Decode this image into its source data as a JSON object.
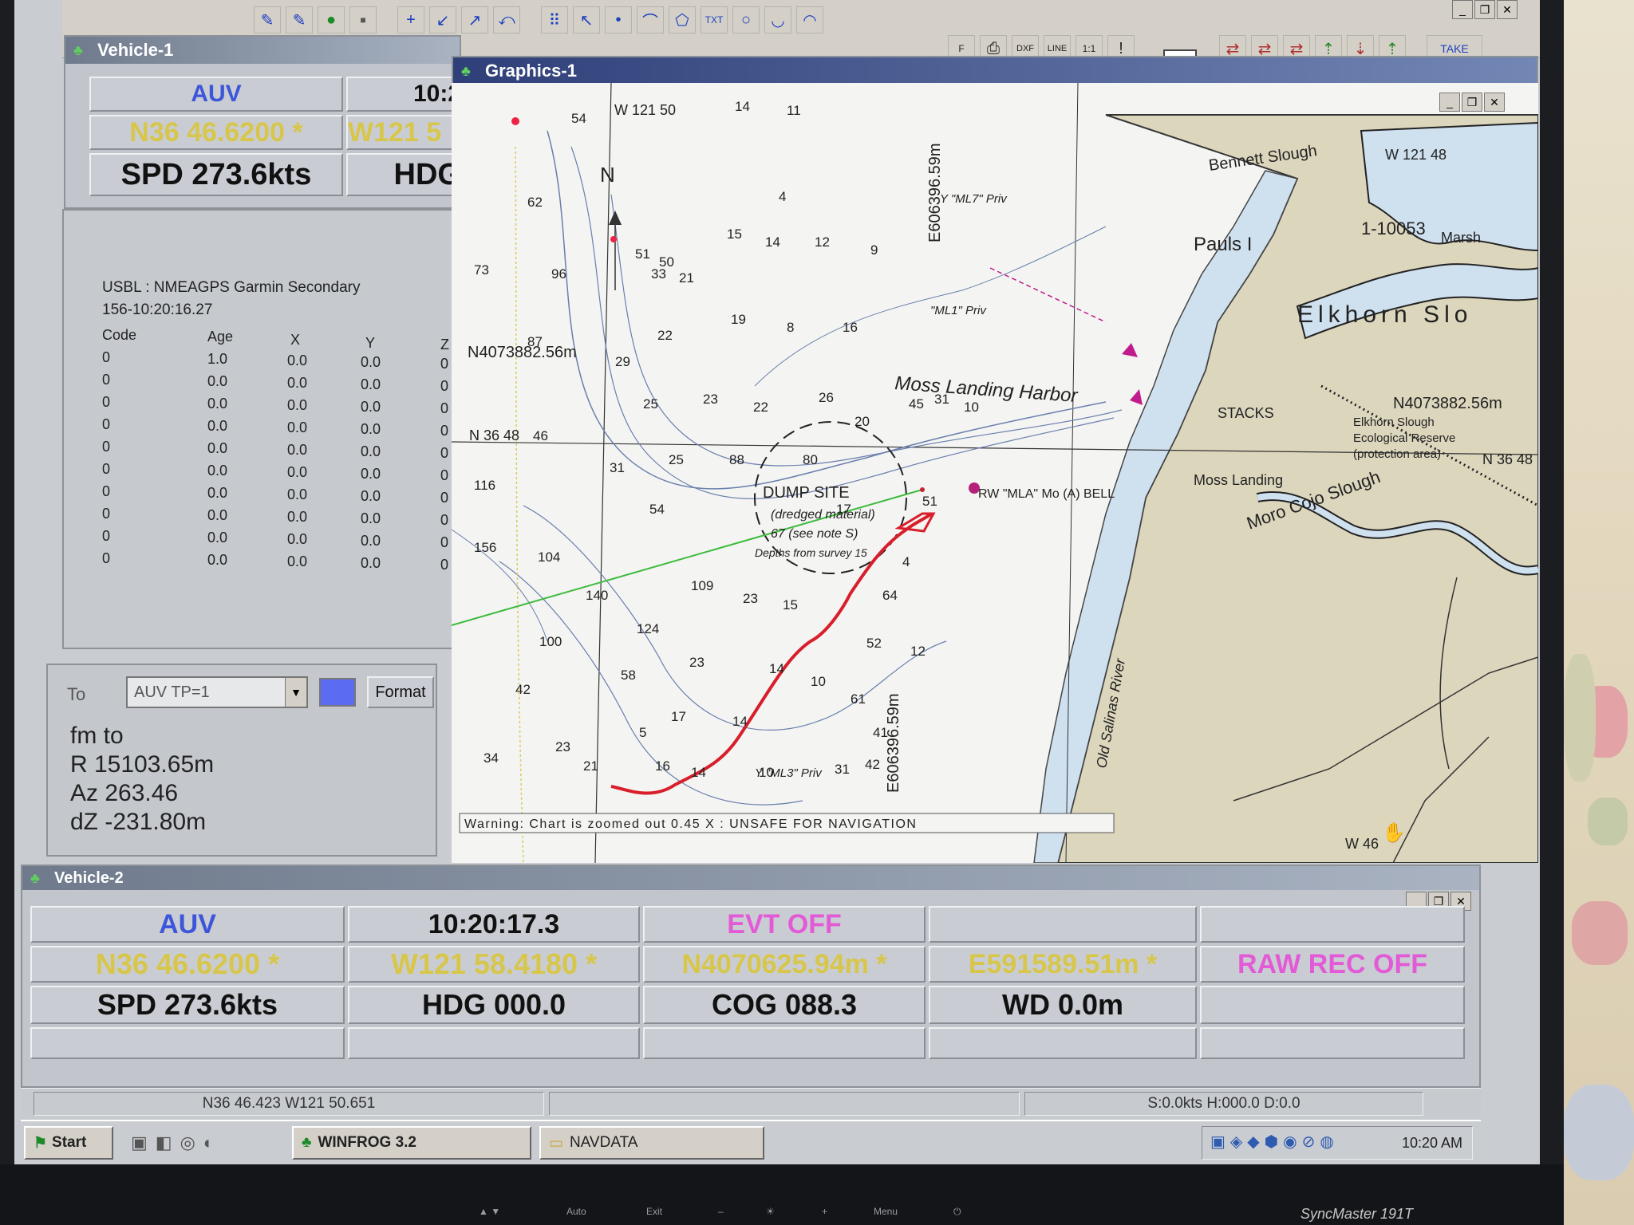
{
  "toolbar": {
    "buttons": [
      "+",
      "↙",
      "↗",
      "⤺",
      "⠿",
      "↖",
      "•",
      "⌒",
      "⬠",
      "TXT",
      "○",
      "◡",
      "◠"
    ],
    "extra": [
      "F",
      "⎙",
      "DXF",
      "LINE",
      "1:1",
      "!"
    ],
    "zoom_value": "1",
    "take_label": "TAKE"
  },
  "vehicle1": {
    "title": "Vehicle-1",
    "name": "AUV",
    "time": "10:2",
    "lat": "N36 46.6200 *",
    "lon": "W121 5",
    "speed": "SPD 273.6kts",
    "heading": "HDG"
  },
  "usbl": {
    "source": "USBL : NMEAGPS Garmin Secondary",
    "timestamp": "156-10:20:16.27",
    "headers": [
      "Code",
      "Age",
      "X",
      "Y",
      "Z"
    ],
    "rows": [
      [
        "0",
        "1.0",
        "0.0",
        "0.0",
        "0"
      ],
      [
        "0",
        "0.0",
        "0.0",
        "0.0",
        "0"
      ],
      [
        "0",
        "0.0",
        "0.0",
        "0.0",
        "0"
      ],
      [
        "0",
        "0.0",
        "0.0",
        "0.0",
        "0"
      ],
      [
        "0",
        "0.0",
        "0.0",
        "0.0",
        "0"
      ],
      [
        "0",
        "0.0",
        "0.0",
        "0.0",
        "0"
      ],
      [
        "0",
        "0.0",
        "0.0",
        "0.0",
        "0"
      ],
      [
        "0",
        "0.0",
        "0.0",
        "0.0",
        "0"
      ],
      [
        "0",
        "0.0",
        "0.0",
        "0.0",
        "0"
      ],
      [
        "0",
        "0.0",
        "0.0",
        "0.0",
        "0"
      ]
    ]
  },
  "target": {
    "to_label": "To",
    "selected": "AUV TP=1",
    "color": "#5b6cf2",
    "format_label": "Format",
    "fm_to": "fm  to",
    "range": "R  15103.65m",
    "azimuth": "Az 263.46",
    "dz": "dZ -231.80m"
  },
  "graphics": {
    "title": "Graphics-1",
    "warning": "Warning: Chart is zoomed out 0.45 X : UNSAFE FOR NAVIGATION",
    "labels": {
      "harbor": "Moss Landing Harbor",
      "slough": "Elkhorn Slo",
      "bennett": "Bennett Slough",
      "pauls": "Pauls I",
      "marsh": "Marsh",
      "moro_cojo": "Moro Cojo Slough",
      "moss_landing": "Moss Landing",
      "stacks": "STACKS",
      "dump_site": "DUMP SITE",
      "dump_note1": "(dredged material)",
      "dump_note2": "67 (see note S)",
      "dump_note3": "Depths from survey 15",
      "old_salinas": "Old Salinas River",
      "reserve1": "Elkhorn Slough",
      "reserve2": "Ecological Reserve",
      "reserve3": "(protection area)",
      "north": "N",
      "grid_n1": "N4073882.56m",
      "grid_n2": "N4073882.56m",
      "grid_e1": "E606396.59m",
      "grid_e2": "E606396.59m",
      "lat_left": "N 36 48",
      "lat_right": "N 36 48",
      "lon_top": "W 121 50",
      "lon_top2": "W 121 48",
      "lon_bottom": "W 46",
      "ref_num": "1-10053",
      "mla": "RW \"MLA\" Mo (A) BELL",
      "ml3": "Y \"ML3\" Priv",
      "ml7": "Y \"ML7\" Priv",
      "ml1": "\"ML1\" Priv"
    },
    "depths": [
      [
        "54",
        150,
        50
      ],
      [
        "51",
        230,
        220
      ],
      [
        "50",
        260,
        230
      ],
      [
        "14",
        355,
        35
      ],
      [
        "11",
        420,
        40
      ],
      [
        "62",
        95,
        155
      ],
      [
        "96",
        125,
        245
      ],
      [
        "87",
        95,
        330
      ],
      [
        "33",
        250,
        245
      ],
      [
        "21",
        285,
        250
      ],
      [
        "22",
        258,
        322
      ],
      [
        "29",
        205,
        355
      ],
      [
        "19",
        350,
        302
      ],
      [
        "8",
        420,
        312
      ],
      [
        "16",
        490,
        312
      ],
      [
        "15",
        345,
        195
      ],
      [
        "14",
        393,
        205
      ],
      [
        "12",
        455,
        205
      ],
      [
        "9",
        525,
        215
      ],
      [
        "4",
        410,
        148
      ],
      [
        "25",
        240,
        408
      ],
      [
        "23",
        315,
        402
      ],
      [
        "22",
        378,
        412
      ],
      [
        "26",
        460,
        400
      ],
      [
        "20",
        505,
        430
      ],
      [
        "46",
        102,
        448
      ],
      [
        "31",
        198,
        488
      ],
      [
        "25",
        272,
        478
      ],
      [
        "88",
        348,
        478
      ],
      [
        "80",
        440,
        478
      ],
      [
        "54",
        248,
        540
      ],
      [
        "104",
        108,
        600
      ],
      [
        "140",
        168,
        648
      ],
      [
        "109",
        300,
        636
      ],
      [
        "23",
        365,
        652
      ],
      [
        "15",
        415,
        660
      ],
      [
        "124",
        232,
        690
      ],
      [
        "100",
        110,
        706
      ],
      [
        "42",
        80,
        766
      ],
      [
        "58",
        212,
        748
      ],
      [
        "23",
        298,
        732
      ],
      [
        "14",
        398,
        740
      ],
      [
        "10",
        450,
        756
      ],
      [
        "17",
        275,
        800
      ],
      [
        "14",
        352,
        806
      ],
      [
        "5",
        235,
        820
      ],
      [
        "23",
        130,
        838
      ],
      [
        "21",
        165,
        862
      ],
      [
        "16",
        255,
        862
      ],
      [
        "14",
        300,
        870
      ],
      [
        "10",
        385,
        870
      ],
      [
        "31",
        480,
        866
      ],
      [
        "42",
        518,
        860
      ],
      [
        "34",
        40,
        852
      ],
      [
        "61",
        500,
        778
      ],
      [
        "17",
        482,
        540
      ],
      [
        "45",
        573,
        408
      ],
      [
        "31",
        605,
        402
      ],
      [
        "10",
        642,
        412
      ],
      [
        "51",
        590,
        530
      ],
      [
        "64",
        540,
        648
      ],
      [
        "52",
        520,
        708
      ],
      [
        "41",
        528,
        820
      ],
      [
        "12",
        575,
        718
      ],
      [
        "4",
        565,
        606
      ],
      [
        "156",
        28,
        588
      ],
      [
        "116",
        28,
        510
      ],
      [
        "73",
        28,
        240
      ]
    ]
  },
  "vehicle2": {
    "title": "Vehicle-2",
    "row1": [
      "AUV",
      "10:20:17.3",
      "EVT OFF",
      "",
      ""
    ],
    "row2": [
      "N36 46.6200 *",
      "W121 58.4180 *",
      "N4070625.94m *",
      "E591589.51m *",
      "RAW REC OFF"
    ],
    "row3": [
      "SPD 273.6kts",
      "HDG 000.0",
      "COG 088.3",
      "WD 0.0m",
      ""
    ]
  },
  "status": {
    "position": "N36 46.423 W121 50.651",
    "motion": "S:0.0kts H:000.0 D:0.0"
  },
  "taskbar": {
    "start": "Start",
    "apps": [
      "WINFROG 3.2",
      "NAVDATA"
    ],
    "clock": "10:20 AM"
  },
  "bezel": {
    "buttons": [
      "▲ ▼",
      "Auto",
      "Exit",
      "–",
      "☀",
      "+",
      "Menu",
      "⏻"
    ],
    "brand": "SyncMaster 191T"
  }
}
